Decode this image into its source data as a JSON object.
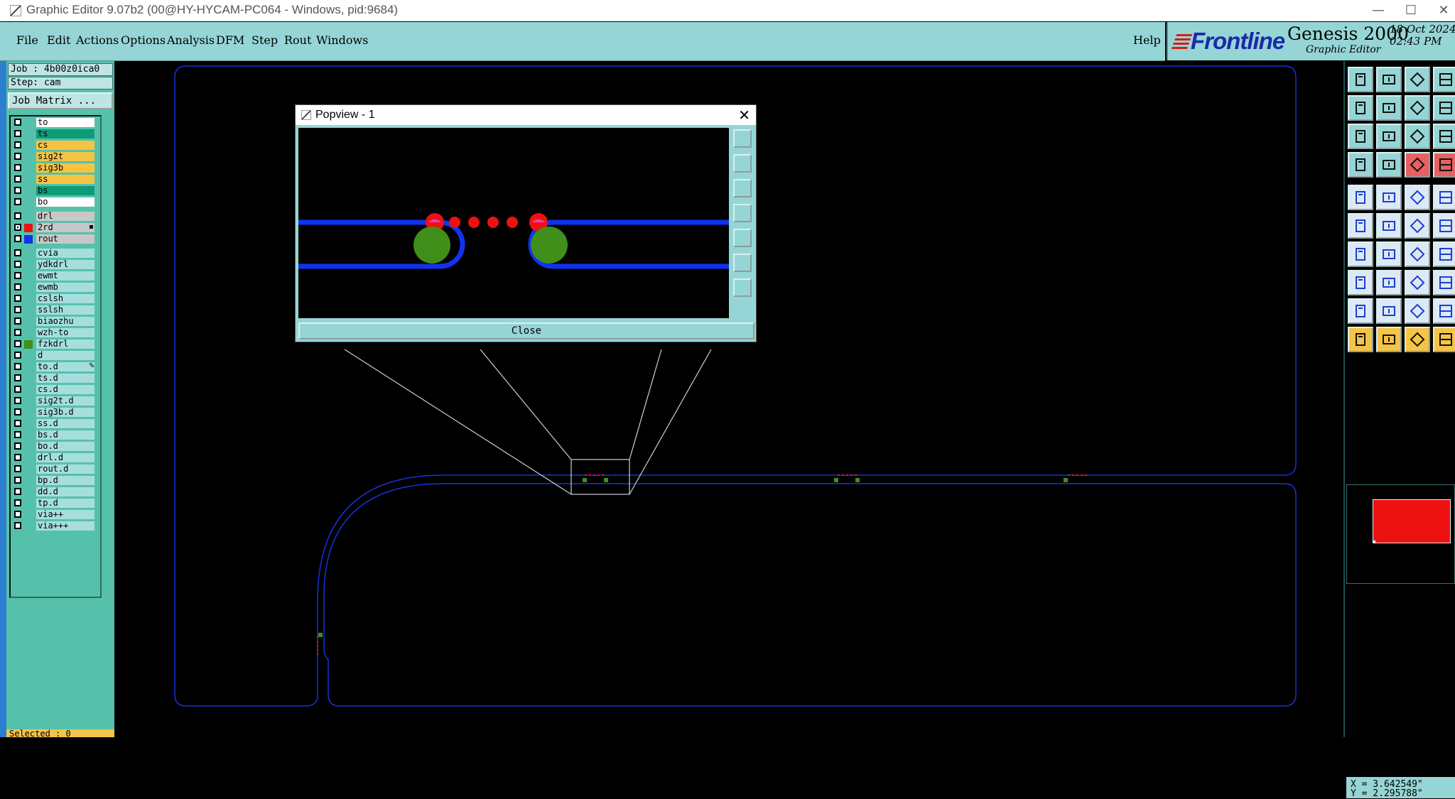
{
  "window": {
    "title": "Graphic Editor 9.07b2 (00@HY-HYCAM-PC064 - Windows, pid:9684)",
    "minimize": "—",
    "maximize": "☐",
    "close": "✕"
  },
  "menu": {
    "file": "File",
    "edit": "Edit",
    "actions": "Actions",
    "options": "Options",
    "analysis": "Analysis",
    "dfm": "DFM",
    "step": "Step",
    "rout": "Rout",
    "windows": "Windows",
    "help": "Help"
  },
  "logo": {
    "brand": "Frontline",
    "product": "Genesis 2000",
    "subtitle": "Graphic Editor",
    "date": "18 Oct 2024",
    "time": "02:43 PM"
  },
  "job": {
    "job_label": "Job : 4b00z0ica0",
    "step_label": "Step: cam",
    "matrix_button": "Job Matrix ..."
  },
  "layers": [
    {
      "name": "to",
      "bg": "#ffffff",
      "swatch": ""
    },
    {
      "name": "ts",
      "bg": "#0c9c78",
      "swatch": ""
    },
    {
      "name": "cs",
      "bg": "#f5c444",
      "swatch": ""
    },
    {
      "name": "sig2t",
      "bg": "#f5c444",
      "swatch": ""
    },
    {
      "name": "sig3b",
      "bg": "#f5c444",
      "swatch": ""
    },
    {
      "name": "ss",
      "bg": "#f5c444",
      "swatch": ""
    },
    {
      "name": "bs",
      "bg": "#0c9c78",
      "swatch": ""
    },
    {
      "name": "bo",
      "bg": "#ffffff",
      "swatch": ""
    },
    {
      "name": "drl",
      "bg": "#c8c8c8",
      "swatch": ""
    },
    {
      "name": "2rd",
      "bg": "#c8c8c8",
      "swatch": "#ee1111",
      "checked": true,
      "mark": "▪"
    },
    {
      "name": "rout",
      "bg": "#c8c8c8",
      "swatch": "#1133ee"
    },
    {
      "name": "cvia",
      "bg": "#a6dede",
      "swatch": ""
    },
    {
      "name": "ydkdrl",
      "bg": "#a6dede",
      "swatch": ""
    },
    {
      "name": "ewmt",
      "bg": "#a6dede",
      "swatch": ""
    },
    {
      "name": "ewmb",
      "bg": "#a6dede",
      "swatch": ""
    },
    {
      "name": "cslsh",
      "bg": "#a6dede",
      "swatch": ""
    },
    {
      "name": "sslsh",
      "bg": "#a6dede",
      "swatch": ""
    },
    {
      "name": "biaozhu",
      "bg": "#a6dede",
      "swatch": ""
    },
    {
      "name": "wzh-to",
      "bg": "#a6dede",
      "swatch": ""
    },
    {
      "name": "fzkdrl",
      "bg": "#a6dede",
      "swatch": "#3f8f1a"
    },
    {
      "name": "d",
      "bg": "#a6dede",
      "swatch": ""
    },
    {
      "name": "to.d",
      "bg": "#a6dede",
      "swatch": "",
      "mark": "✎"
    },
    {
      "name": "ts.d",
      "bg": "#a6dede",
      "swatch": ""
    },
    {
      "name": "cs.d",
      "bg": "#a6dede",
      "swatch": ""
    },
    {
      "name": "sig2t.d",
      "bg": "#a6dede",
      "swatch": ""
    },
    {
      "name": "sig3b.d",
      "bg": "#a6dede",
      "swatch": ""
    },
    {
      "name": "ss.d",
      "bg": "#a6dede",
      "swatch": ""
    },
    {
      "name": "bs.d",
      "bg": "#a6dede",
      "swatch": ""
    },
    {
      "name": "bo.d",
      "bg": "#a6dede",
      "swatch": ""
    },
    {
      "name": "drl.d",
      "bg": "#a6dede",
      "swatch": ""
    },
    {
      "name": "rout.d",
      "bg": "#a6dede",
      "swatch": ""
    },
    {
      "name": "bp.d",
      "bg": "#a6dede",
      "swatch": ""
    },
    {
      "name": "dd.d",
      "bg": "#a6dede",
      "swatch": ""
    },
    {
      "name": "tp.d",
      "bg": "#a6dede",
      "swatch": ""
    },
    {
      "name": "via++",
      "bg": "#a6dede",
      "swatch": ""
    },
    {
      "name": "via+++",
      "bg": "#a6dede",
      "swatch": ""
    }
  ],
  "status": {
    "selected": "Selected : 0",
    "x": "X = 3.642549\"",
    "y": "Y = 2.295788\""
  },
  "popview": {
    "title": "Popview - 1",
    "close_x": "✕",
    "close_button": "Close"
  },
  "colors": {
    "panel": "#96d5d5",
    "layer_panel": "#56c1ab",
    "rout_blue": "#1133ee",
    "pad_green": "#3f8f1a",
    "drill_red": "#ee1111"
  }
}
